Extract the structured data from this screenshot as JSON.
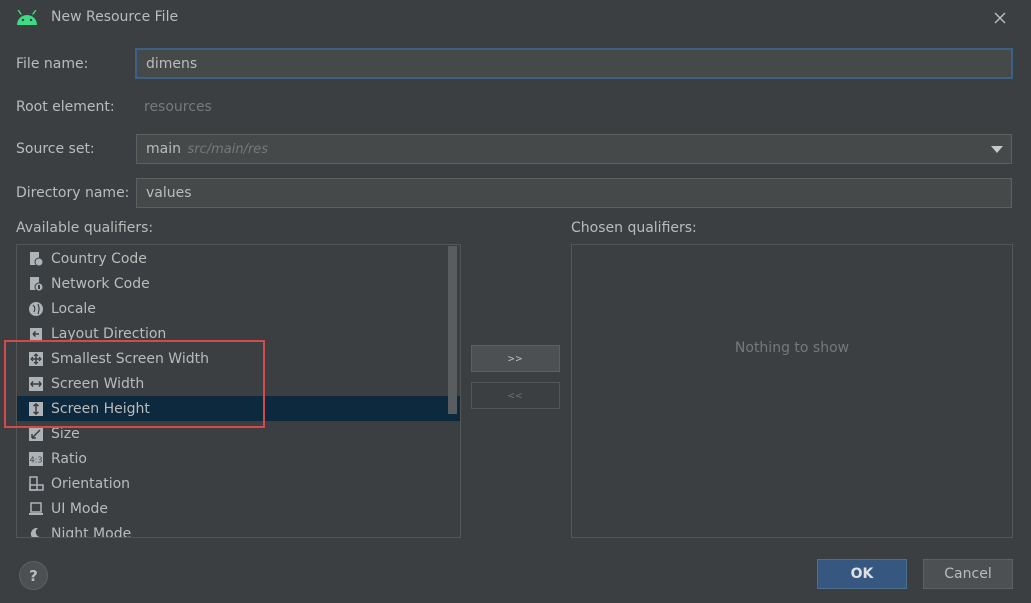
{
  "window": {
    "title": "New Resource File",
    "accent_color": "#3ddc84"
  },
  "form": {
    "file_name_label": "File name:",
    "file_name_value": "dimens",
    "root_element_label": "Root element:",
    "root_element_value": "resources",
    "source_set_label": "Source set:",
    "source_set_value": "main",
    "source_set_path": "src/main/res",
    "directory_name_label": "Directory name:",
    "directory_name_value": "values"
  },
  "qualifiers": {
    "available_label": "Available qualifiers:",
    "chosen_label": "Chosen qualifiers:",
    "chosen_empty_text": "Nothing to show",
    "add_button": ">>",
    "remove_button": "<<",
    "available": [
      {
        "label": "Country Code",
        "icon": "country-code-icon",
        "selected": false
      },
      {
        "label": "Network Code",
        "icon": "network-code-icon",
        "selected": false
      },
      {
        "label": "Locale",
        "icon": "globe-icon",
        "selected": false
      },
      {
        "label": "Layout Direction",
        "icon": "layout-direction-icon",
        "selected": false
      },
      {
        "label": "Smallest Screen Width",
        "icon": "smallest-width-icon",
        "selected": false
      },
      {
        "label": "Screen Width",
        "icon": "width-arrows-icon",
        "selected": false
      },
      {
        "label": "Screen Height",
        "icon": "height-arrows-icon",
        "selected": true
      },
      {
        "label": "Size",
        "icon": "size-icon",
        "selected": false
      },
      {
        "label": "Ratio",
        "icon": "ratio-icon",
        "selected": false
      },
      {
        "label": "Orientation",
        "icon": "orientation-icon",
        "selected": false
      },
      {
        "label": "UI Mode",
        "icon": "ui-mode-icon",
        "selected": false
      },
      {
        "label": "Night Mode",
        "icon": "night-mode-icon",
        "selected": false
      }
    ]
  },
  "footer": {
    "help_label": "?",
    "ok_label": "OK",
    "cancel_label": "Cancel"
  },
  "colors": {
    "background": "#3c3f41",
    "selection": "#0d293e",
    "highlight_box": "#d24a4a",
    "primary_button": "#365880"
  }
}
